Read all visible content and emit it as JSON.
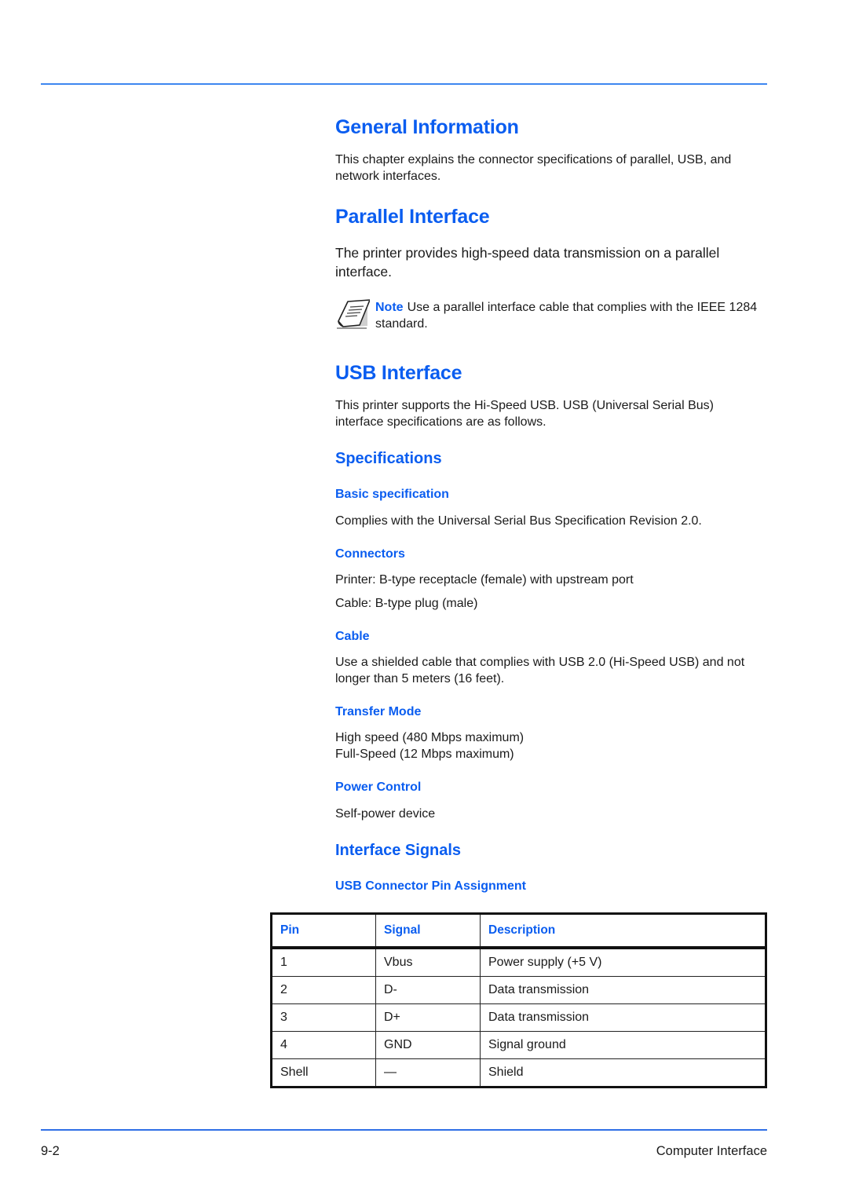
{
  "colors": {
    "heading": "#0a5df0",
    "rule": "#3d86f0",
    "text": "#1a1a1a"
  },
  "sections": {
    "general": {
      "title": "General Information",
      "body": "This chapter explains the connector specifications of parallel, USB, and network interfaces."
    },
    "parallel": {
      "title": "Parallel Interface",
      "body": "The printer provides high-speed data transmission on a parallel interface.",
      "note": {
        "icon": "note-paper-icon",
        "label": "Note",
        "text": "Use a parallel interface cable that complies with the IEEE 1284 standard."
      }
    },
    "usb": {
      "title": "USB Interface",
      "body": "This printer supports the Hi-Speed USB. USB (Universal Serial Bus) interface specifications are as follows.",
      "specifications": {
        "title": "Specifications",
        "basic": {
          "title": "Basic specification",
          "body": "Complies with the Universal Serial Bus Specification Revision 2.0."
        },
        "connectors": {
          "title": "Connectors",
          "lines": [
            "Printer: B-type receptacle (female) with upstream port",
            "Cable: B-type plug (male)"
          ]
        },
        "cable": {
          "title": "Cable",
          "body": "Use a shielded cable that complies with USB 2.0 (Hi-Speed USB) and not longer than 5 meters (16 feet)."
        },
        "transfer_mode": {
          "title": "Transfer Mode",
          "lines": [
            "High speed (480 Mbps maximum)",
            "Full-Speed (12 Mbps maximum)"
          ]
        },
        "power_control": {
          "title": "Power Control",
          "body": "Self-power device"
        }
      },
      "signals": {
        "title": "Interface Signals",
        "table_title": "USB Connector Pin Assignment",
        "columns": [
          "Pin",
          "Signal",
          "Description"
        ],
        "rows": [
          [
            "1",
            "Vbus",
            "Power supply (+5 V)"
          ],
          [
            "2",
            "D-",
            "Data transmission"
          ],
          [
            "3",
            "D+",
            "Data transmission"
          ],
          [
            "4",
            "GND",
            "Signal ground"
          ],
          [
            "Shell",
            "—",
            "Shield"
          ]
        ]
      }
    }
  },
  "footer": {
    "page_number": "9-2",
    "chapter": "Computer Interface"
  }
}
